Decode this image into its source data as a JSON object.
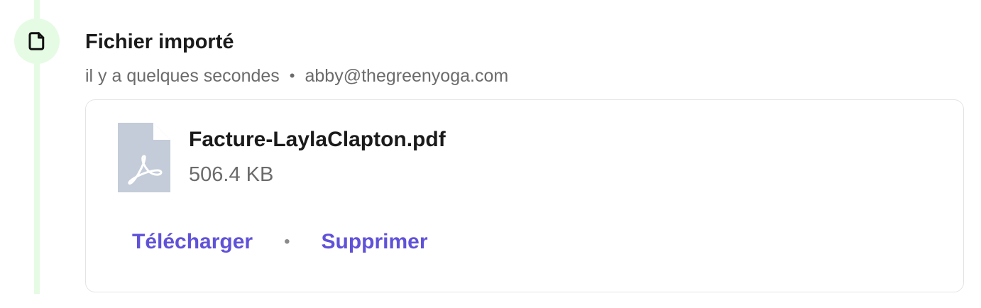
{
  "colors": {
    "timeline": "#e6fbe3",
    "link": "#6052d8",
    "muted_text": "#6b6b6b",
    "file_icon": "#c3ccd8"
  },
  "event": {
    "icon": "document-icon",
    "title": "Fichier importé",
    "time": "il y a quelques secondes",
    "separator": "•",
    "user": "abby@thegreenyoga.com"
  },
  "file": {
    "icon": "pdf-file-icon",
    "name": "Facture-LaylaClapton.pdf",
    "size": "506.4 KB"
  },
  "actions": {
    "download_label": "Télécharger",
    "separator": "•",
    "delete_label": "Supprimer"
  }
}
